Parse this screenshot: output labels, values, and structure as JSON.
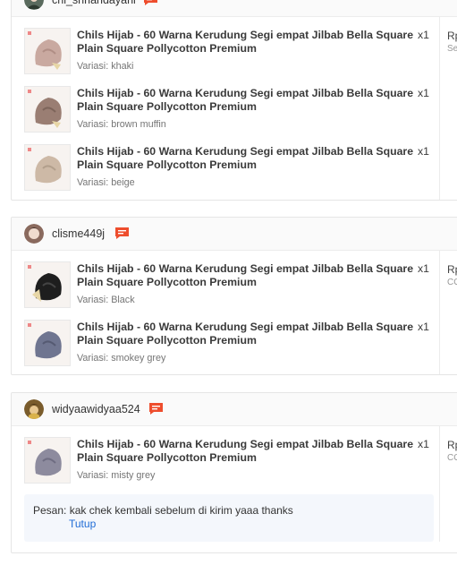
{
  "orders": [
    {
      "username": "chi_shriandayani",
      "side_price": "Rp",
      "side_sub": "Se",
      "items": [
        {
          "name": "Chils Hijab - 60 Warna Kerudung Segi empat Jilbab Bella Square Plain Square Pollycotton Premium",
          "qty": "x1",
          "variant": "Variasi: khaki",
          "swatch": "#c9a9a0"
        },
        {
          "name": "Chils Hijab - 60 Warna Kerudung Segi empat Jilbab Bella Square Plain Square Pollycotton Premium",
          "qty": "x1",
          "variant": "Variasi: brown muffin",
          "swatch": "#9a7e73"
        },
        {
          "name": "Chils Hijab - 60 Warna Kerudung Segi empat Jilbab Bella Square Plain Square Pollycotton Premium",
          "qty": "x1",
          "variant": "Variasi: beige",
          "swatch": "#cdb9a6"
        }
      ]
    },
    {
      "username": "clisme449j",
      "side_price": "Rp",
      "side_sub": "CO",
      "items": [
        {
          "name": "Chils Hijab - 60 Warna Kerudung Segi empat Jilbab Bella Square Plain Square Pollycotton Premium",
          "qty": "x1",
          "variant": "Variasi: Black",
          "swatch": "#1e1e1e"
        },
        {
          "name": "Chils Hijab - 60 Warna Kerudung Segi empat Jilbab Bella Square Plain Square Pollycotton Premium",
          "qty": "x1",
          "variant": "Variasi: smokey grey",
          "swatch": "#6f7590"
        }
      ]
    },
    {
      "username": "widyaawidyaa524",
      "side_price": "Rp",
      "side_sub": "CO",
      "items": [
        {
          "name": "Chils Hijab - 60 Warna Kerudung Segi empat Jilbab Bella Square Plain Square Pollycotton Premium",
          "qty": "x1",
          "variant": "Variasi: misty grey",
          "swatch": "#8d8b9e"
        }
      ],
      "note": {
        "label": "Pesan:",
        "text": "kak chek kembali sebelum di kirim yaaa thanks",
        "link": "Tutup"
      }
    }
  ],
  "colors": {
    "chat_icon": "#ee4d2d",
    "link": "#1e6bd6"
  }
}
